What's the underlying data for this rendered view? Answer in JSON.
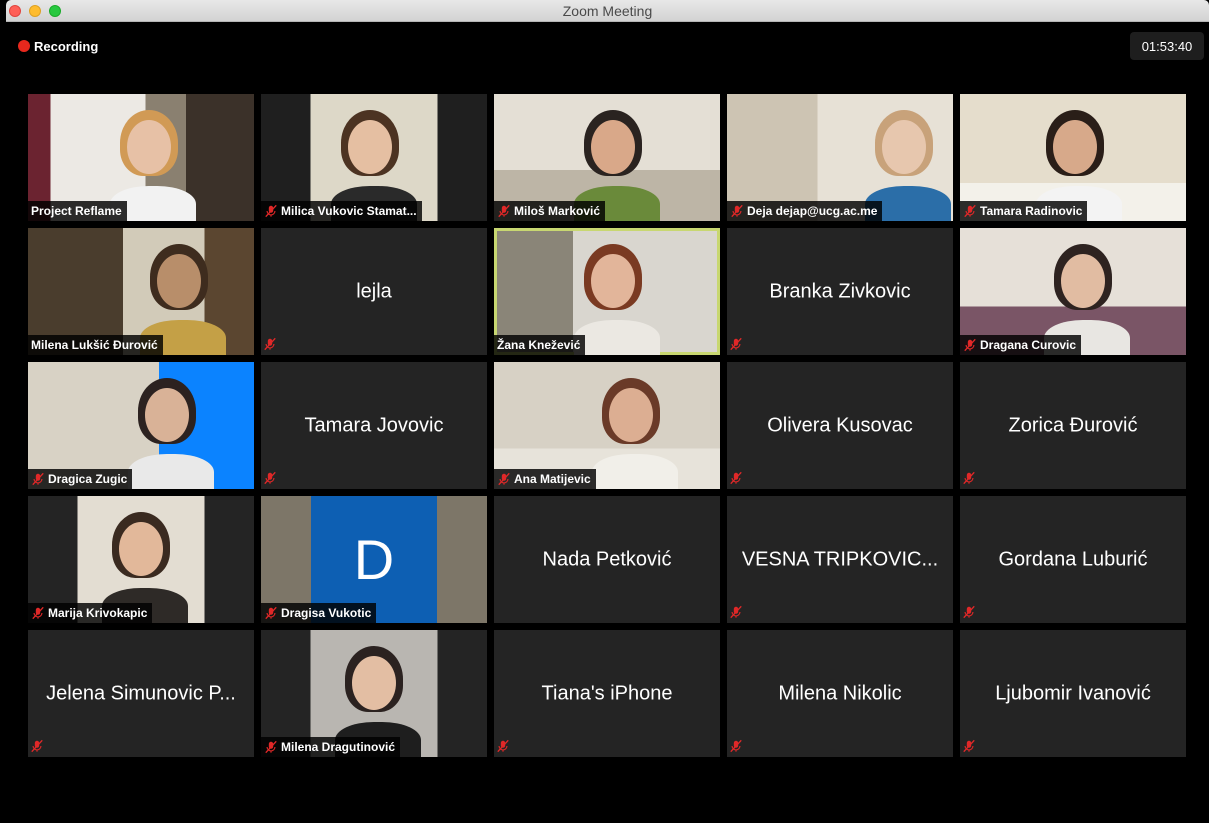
{
  "window": {
    "title": "Zoom Meeting"
  },
  "status": {
    "recording_label": "Recording",
    "timer": "01:53:40"
  },
  "tiles": [
    {
      "name": "Project Reflame",
      "video": true,
      "muted": false
    },
    {
      "name": "Milica Vukovic Stamat...",
      "video": true,
      "muted": true
    },
    {
      "name": "Miloš Marković",
      "video": true,
      "muted": true
    },
    {
      "name": "Deja dejap@ucg.ac.me",
      "video": true,
      "muted": true
    },
    {
      "name": "Tamara Radinovic",
      "video": true,
      "muted": true
    },
    {
      "name": "Milena Lukšić Đurović",
      "video": true,
      "muted": false
    },
    {
      "name": "lejla",
      "video": false,
      "muted": true
    },
    {
      "name": "Žana Knežević",
      "video": true,
      "muted": false,
      "speaking": true
    },
    {
      "name": "Branka Zivkovic",
      "video": false,
      "muted": true
    },
    {
      "name": "Dragana Curovic",
      "video": true,
      "muted": true
    },
    {
      "name": "Dragica Zugic",
      "video": true,
      "muted": true
    },
    {
      "name": "Tamara Jovovic",
      "video": false,
      "muted": true
    },
    {
      "name": "Ana Matijevic",
      "video": true,
      "muted": true
    },
    {
      "name": "Olivera Kusovac",
      "video": false,
      "muted": true
    },
    {
      "name": "Zorica Đurović",
      "video": false,
      "muted": true
    },
    {
      "name": "Marija Krivokapic",
      "video": true,
      "muted": true
    },
    {
      "name": "Dragisa Vukotic",
      "video": true,
      "muted": true,
      "avatar_letter": "D"
    },
    {
      "name": "Nada Petković",
      "video": false,
      "muted": false
    },
    {
      "name": "VESNA TRIPKOVIC...",
      "video": false,
      "muted": true
    },
    {
      "name": "Gordana Luburić",
      "video": false,
      "muted": true
    },
    {
      "name": "Jelena Simunovic P...",
      "video": false,
      "muted": true
    },
    {
      "name": "Milena Dragutinović",
      "video": true,
      "muted": true
    },
    {
      "name": "Tiana's iPhone",
      "video": false,
      "muted": true
    },
    {
      "name": "Milena Nikolic",
      "video": false,
      "muted": true
    },
    {
      "name": "Ljubomir Ivanović",
      "video": false,
      "muted": true
    }
  ],
  "colors": {
    "speaking_border": "#c8d771",
    "tile_bg": "#242424",
    "recording_dot": "#e8281d",
    "muted_icon": "#e02828",
    "avatar_bg": "#0d5fb3"
  }
}
